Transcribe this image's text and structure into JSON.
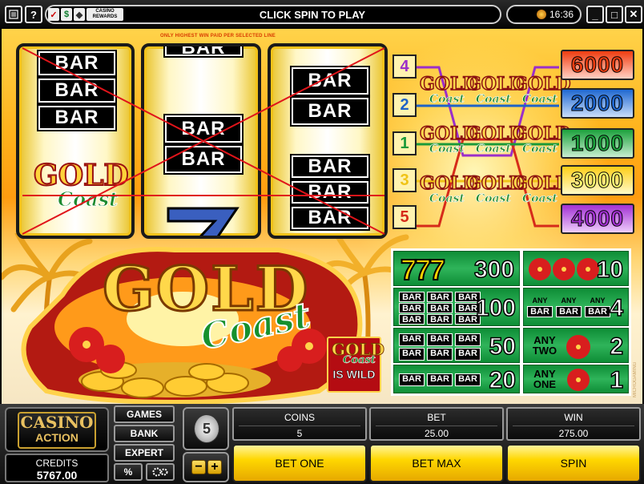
{
  "title_bar": {
    "menu_icon": "menu-list-icon",
    "help_label": "?",
    "rewards_logo": "CASINO REWARDS",
    "message": "CLICK SPIN TO PLAY",
    "clock": "16:36",
    "minimize_label": "_",
    "maximize_label": "□",
    "close_label": "✕"
  },
  "game": {
    "notice": "ONLY HIGHEST WIN PAID PER SELECTED LINE",
    "logo": {
      "word1": "GOLD",
      "word2": "Coast"
    },
    "reel_symbol": {
      "word1": "GOLD",
      "word2": "Coast"
    },
    "bar_label": "BAR",
    "wild": {
      "word1": "GOLD",
      "word2": "Coast",
      "text": "IS WILD"
    },
    "side_credit": "MICROGAMING"
  },
  "paylines": [
    {
      "number": "4",
      "win": "6000",
      "num_color": "#9b2fc9",
      "win_color": "#e33a10"
    },
    {
      "number": "2",
      "win": "2000",
      "num_color": "#1e63c7",
      "win_color": "#1e63c7"
    },
    {
      "number": "1",
      "win": "1000",
      "num_color": "#1b9a3a",
      "win_color": "#1b9a3a"
    },
    {
      "number": "3",
      "win": "3000",
      "num_color": "#f0c417",
      "win_color": "#f0c417"
    },
    {
      "number": "5",
      "win": "4000",
      "num_color": "#d62b1a",
      "win_color": "#9b2fc9"
    }
  ],
  "paytable": {
    "sevens": {
      "symbol": "777",
      "value": "300"
    },
    "three_flowers": {
      "value": "10"
    },
    "nine_bars": {
      "value": "100"
    },
    "any_bar": {
      "label1": "ANY",
      "label2": "BAR",
      "value": "4"
    },
    "six_bars": {
      "value": "50"
    },
    "any_two": {
      "label1": "ANY",
      "label2": "TWO",
      "value": "2"
    },
    "three_bars": {
      "value": "20"
    },
    "any_one": {
      "label1": "ANY",
      "label2": "ONE",
      "value": "1"
    }
  },
  "panel": {
    "logo_line1": "CASINO",
    "logo_line2": "ACTION",
    "credits_label": "CREDITS",
    "credits_value": "5767.00",
    "games_label": "GAMES",
    "bank_label": "BANK",
    "expert_label": "EXPERT",
    "percent_label": "%",
    "settings_icon": "gears-icon",
    "coin_size": "5",
    "coins_label": "COINS",
    "coins_value": "5",
    "bet_label": "BET",
    "bet_value": "25.00",
    "win_label": "WIN",
    "win_value": "275.00",
    "bet_one_label": "BET ONE",
    "bet_max_label": "BET MAX",
    "spin_label": "SPIN"
  }
}
